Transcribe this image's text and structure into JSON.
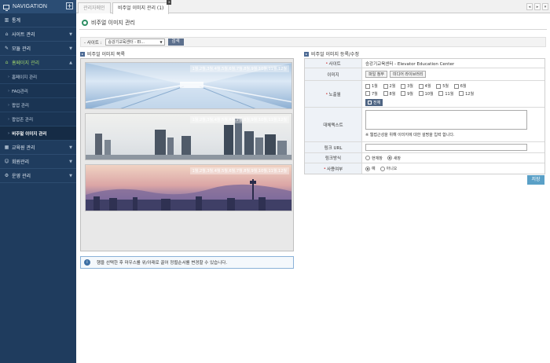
{
  "nav": {
    "title": "NAVIGATION",
    "items": [
      {
        "label": "통계",
        "icon": "chart-icon"
      },
      {
        "label": "사이트 관리",
        "icon": "home-icon"
      },
      {
        "label": "모듈 관리",
        "icon": "edit-icon"
      },
      {
        "label": "홈페이지 관리",
        "icon": "home-icon"
      }
    ],
    "sub_items": [
      "홈페이지 관리",
      "FAQ관리",
      "팝업 관리",
      "팝업존 관리",
      "비주얼 이미지 관리"
    ],
    "bottom_items": [
      {
        "label": "교육원 관리",
        "icon": "building-icon"
      },
      {
        "label": "회원관리",
        "icon": "user-icon"
      },
      {
        "label": "운영 관리",
        "icon": "gear-icon"
      }
    ]
  },
  "tabs": {
    "first": "관리자메인",
    "second": "비주얼 이미지 관리 (1)"
  },
  "page": {
    "title": "비주얼 이미지 관리",
    "search_label": "- 사이트 :",
    "search_select": "승강기교육센터 - El...",
    "search_button": "검색"
  },
  "list": {
    "heading": "비주얼 이미지 목록",
    "months_text": "1월,2월,3월,4월,5월,6월,7월,8월,9월,10월,11월,12월",
    "hint": "행을 선택한 후 마우스를 위/아래로 끌어 정렬순서를 변경할 수 있습니다."
  },
  "form": {
    "heading": "비주얼 이미지 등록/수정",
    "site_label": "사이트",
    "site_value": "승강기교육센터 - Elevator Education Center",
    "image_label": "이미지",
    "attach_button": "파일 첨부",
    "media_button": "미디어 라이브러리",
    "exposure_label": "노출월",
    "months": [
      "1월",
      "2월",
      "3월",
      "4월",
      "5월",
      "6월",
      "7월",
      "8월",
      "9월",
      "10월",
      "11월",
      "12월"
    ],
    "all_button": "전체",
    "alt_label": "대체텍스트",
    "alt_hint": "※ 웹접근성을 위해 이미지에 대한 설명을 입력 합니다.",
    "link_label": "링크 URL",
    "link_method_label": "링크방식",
    "link_options": [
      "현재창",
      "새창"
    ],
    "use_label": "사용여부",
    "use_options": [
      "예",
      "아니오"
    ],
    "save_button": "저장"
  }
}
